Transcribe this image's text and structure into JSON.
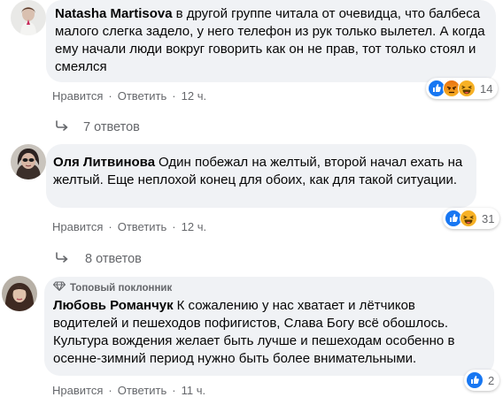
{
  "comments": [
    {
      "author": "Natasha Martisova",
      "text": "в другой группе читала от очевидца, что балбеса малого слегка задело, у него телефон из рук только вылетел. А когда ему начали люди вокруг говорить как он не прав, тот только стоял и смеялся",
      "like_label": "Нравится",
      "reply_label": "Ответить",
      "time": "12 ч.",
      "replies_label": "7 ответов",
      "reaction_count": "14",
      "reactions": [
        "like-icon",
        "angry-icon",
        "haha-icon"
      ]
    },
    {
      "author": "Оля Литвинова",
      "text": "Один побежал на желтый, второй начал ехать на желтый. Еще неплохой конец для обоих, как для такой ситуации.",
      "like_label": "Нравится",
      "reply_label": "Ответить",
      "time": "12 ч.",
      "replies_label": "8 ответов",
      "reaction_count": "31",
      "reactions": [
        "like-icon",
        "haha-icon"
      ]
    },
    {
      "badge": "Топовый поклонник",
      "author": "Любовь Романчук",
      "text": "К сожалению у нас хватает и лётчиков водителей и пешеходов пофигистов, Слава Богу всё обошлось. Культура вождения желает быть лучше и пешеходам особенно в осенне-зимний период нужно быть более внимательными.",
      "like_label": "Нравится",
      "reply_label": "Ответить",
      "time": "11 ч.",
      "reaction_count": "2",
      "reactions": [
        "like-icon"
      ]
    }
  ],
  "colors": {
    "bubble": "#f0f2f5",
    "secondary_text": "#65676b",
    "like_blue": "#1877f2",
    "angry_orange": "#e9710f",
    "haha_yellow": "#f7b125"
  }
}
